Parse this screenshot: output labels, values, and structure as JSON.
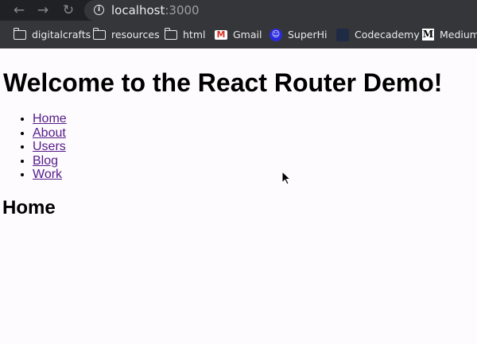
{
  "browser": {
    "url_host": "localhost",
    "url_port": ":3000",
    "bookmarks": [
      {
        "label": "digitalcrafts",
        "icon": "folder-icon"
      },
      {
        "label": "resources",
        "icon": "folder-icon"
      },
      {
        "label": "html",
        "icon": "folder-icon"
      },
      {
        "label": "Gmail",
        "icon": "gmail-icon"
      },
      {
        "label": "SuperHi",
        "icon": "superhi-icon"
      },
      {
        "label": "Codecademy",
        "icon": "codecademy-icon"
      },
      {
        "label": "Medium",
        "icon": "medium-icon"
      }
    ]
  },
  "page": {
    "heading": "Welcome to the React Router Demo!",
    "nav_links": [
      "Home",
      "About",
      "Users",
      "Blog",
      "Work"
    ],
    "route_title": "Home"
  },
  "colors": {
    "toolbar": "#202124",
    "bookmarks_bar": "#35363a",
    "page_bg": "#fdfbfd",
    "visited_link": "#551a8b"
  }
}
